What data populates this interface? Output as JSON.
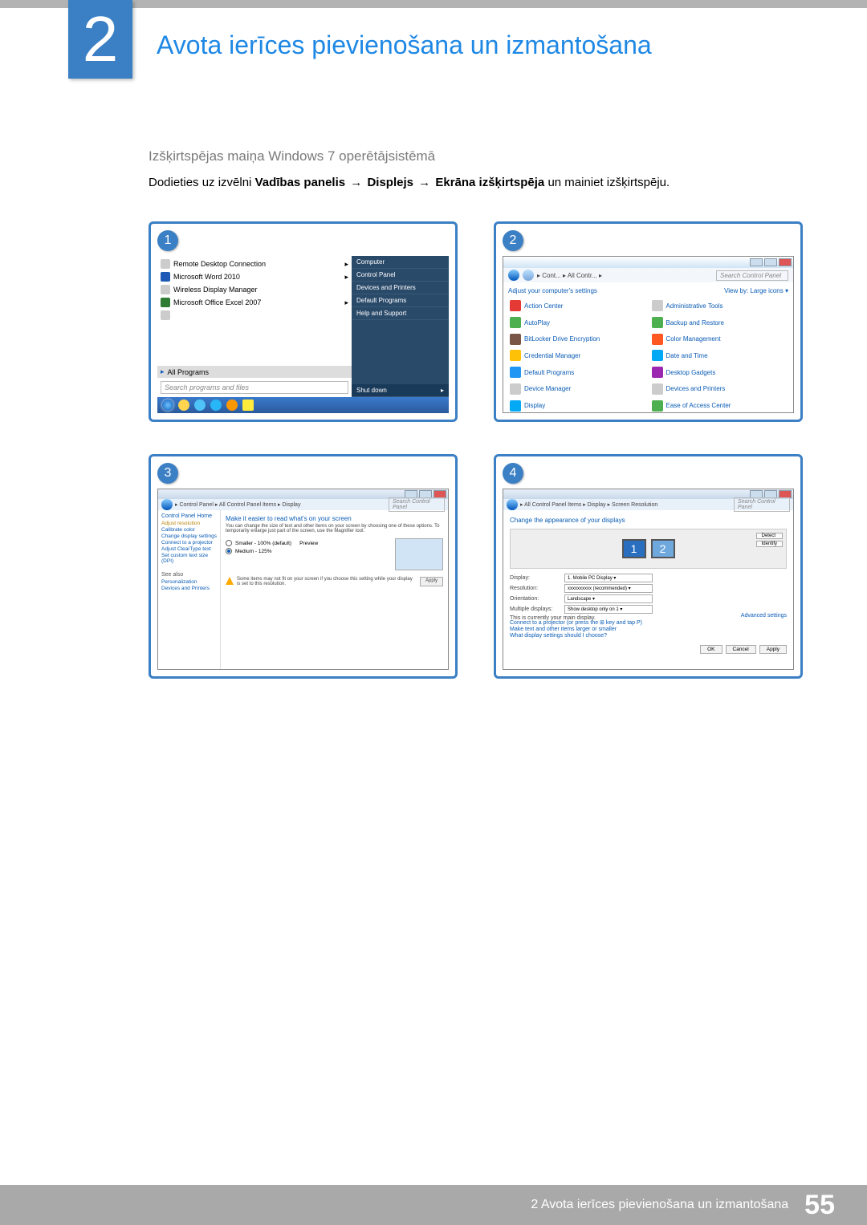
{
  "chapter_number": "2",
  "chapter_title": "Avota ierīces pievienošana un izmantošana",
  "subtitle": "Izšķirtspējas maiņa Windows 7 operētājsistēmā",
  "instruction_prefix": "Dodieties uz izvēlni ",
  "instruction_b1": "Vadības panelis",
  "instruction_b2": "Displejs",
  "instruction_b3": "Ekrāna izšķirtspēja",
  "instruction_suffix": " un mainiet izšķirtspēju.",
  "arrow": "→",
  "screens": {
    "s1": {
      "num": "1",
      "items": [
        "Remote Desktop Connection",
        "Microsoft Word 2010",
        "Wireless Display Manager",
        "Microsoft Office Excel 2007"
      ],
      "all_programs": "All Programs",
      "search_placeholder": "Search programs and files",
      "right": [
        "Computer",
        "Control Panel",
        "Devices and Printers",
        "Default Programs",
        "Help and Support"
      ],
      "shutdown": "Shut down"
    },
    "s2": {
      "num": "2",
      "crumb": "▸ Cont... ▸ All Contr... ▸",
      "search_placeholder": "Search Control Panel",
      "heading": "Adjust your computer's settings",
      "viewby": "View by:   Large icons ▾",
      "items_left": [
        "Action Center",
        "AutoPlay",
        "BitLocker Drive Encryption",
        "Credential Manager",
        "Default Programs",
        "Device Manager",
        "Display"
      ],
      "items_right": [
        "Administrative Tools",
        "Backup and Restore",
        "Color Management",
        "Date and Time",
        "Desktop Gadgets",
        "Devices and Printers",
        "Ease of Access Center"
      ]
    },
    "s3": {
      "num": "3",
      "crumb": "▸ Control Panel ▸ All Control Panel Items ▸ Display",
      "search_placeholder": "Search Control Panel",
      "side_header": "Control Panel Home",
      "side_links": [
        "Adjust resolution",
        "Calibrate color",
        "Change display settings",
        "Connect to a projector",
        "Adjust ClearType text",
        "Set custom text size (DPI)"
      ],
      "see_also": "See also",
      "see_links": [
        "Personalization",
        "Devices and Printers"
      ],
      "headline": "Make it easier to read what's on your screen",
      "desc": "You can change the size of text and other items on your screen by choosing one of these options. To temporarily enlarge just part of the screen, use the Magnifier tool.",
      "opt1": "Smaller - 100% (default)",
      "preview": "Preview",
      "opt2": "Medium - 125%",
      "warn": "Some items may not fit on your screen if you choose this setting while your display is set to this resolution.",
      "apply": "Apply"
    },
    "s4": {
      "num": "4",
      "crumb": "▸ All Control Panel Items ▸ Display ▸ Screen Resolution",
      "search_placeholder": "Search Control Panel",
      "headline": "Change the appearance of your displays",
      "btn_detect": "Detect",
      "btn_identify": "Identify",
      "row_display_l": "Display:",
      "row_display_v": "1. Mobile PC Display ▾",
      "row_res_l": "Resolution:",
      "row_res_v": "xxxxxxxxxx (recommended) ▾",
      "row_orient_l": "Orientation:",
      "row_orient_v": "Landscape ▾",
      "row_multi_l": "Multiple displays:",
      "row_multi_v": "Show desktop only on 1 ▾",
      "note_main": "This is currently your main display.",
      "advanced": "Advanced settings",
      "lk_projector": "Connect to a projector (or press the ⊞ key and tap P)",
      "lk_larger": "Make text and other items larger or smaller",
      "lk_what": "What display settings should I choose?",
      "ok": "OK",
      "cancel": "Cancel",
      "apply": "Apply"
    }
  },
  "footer_text": "2 Avota ierīces pievienošana un izmantošana",
  "page_number": "55"
}
